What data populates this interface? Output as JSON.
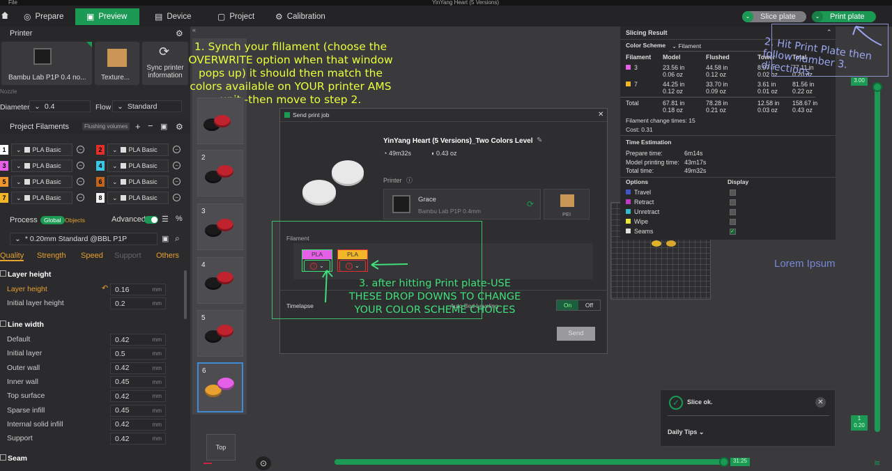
{
  "window": {
    "menu_file": "File",
    "title": "YinYang Heart (5 Versions)"
  },
  "topbar": {
    "tabs": [
      {
        "label": "Prepare",
        "active": false
      },
      {
        "label": "Preview",
        "active": true
      },
      {
        "label": "Device",
        "active": false
      },
      {
        "label": "Project",
        "active": false
      },
      {
        "label": "Calibration",
        "active": false
      }
    ],
    "slice_plate": "Slice plate",
    "print_plate": "Print plate"
  },
  "printer": {
    "header": "Printer",
    "name": "Bambu Lab P1P 0.4 no...",
    "plate": "Texture...",
    "sync_label": "Sync printer information",
    "nozzle_label": "Nozzle",
    "diameter_label": "Diameter",
    "diameter_value": "0.4",
    "flow_label": "Flow",
    "flow_value": "Standard"
  },
  "project_filaments": {
    "header": "Project Filaments",
    "flushing": "Flushing volumes",
    "slots": [
      {
        "num": "1",
        "name": "PLA Basic",
        "color": "#ffffff"
      },
      {
        "num": "2",
        "name": "PLA Basic",
        "color": "#e0302c"
      },
      {
        "num": "3",
        "name": "PLA Basic",
        "color": "#e560e6"
      },
      {
        "num": "4",
        "name": "PLA Basic",
        "color": "#3ec6e6"
      },
      {
        "num": "5",
        "name": "PLA Basic",
        "color": "#f0962e"
      },
      {
        "num": "6",
        "name": "PLA Basic",
        "color": "#c0651e"
      },
      {
        "num": "7",
        "name": "PLA Basic",
        "color": "#f2b629"
      },
      {
        "num": "8",
        "name": "PLA Basic",
        "color": "#f5f5f5"
      }
    ]
  },
  "process": {
    "header": "Process",
    "global": "Global",
    "objects": "Objects",
    "advanced": "Advanced",
    "preset": "* 0.20mm Standard @BBL P1P",
    "tabs": [
      "Quality",
      "Strength",
      "Speed",
      "Support",
      "Others"
    ],
    "layer_height_section": "Layer height",
    "layer_rows": [
      {
        "label": "Layer height",
        "value": "0.16",
        "unit": "mm"
      },
      {
        "label": "Initial layer height",
        "value": "0.2",
        "unit": "mm"
      }
    ],
    "line_width_section": "Line width",
    "line_rows": [
      {
        "label": "Default",
        "value": "0.42",
        "unit": "mm"
      },
      {
        "label": "Initial layer",
        "value": "0.5",
        "unit": "mm"
      },
      {
        "label": "Outer wall",
        "value": "0.42",
        "unit": "mm"
      },
      {
        "label": "Inner wall",
        "value": "0.45",
        "unit": "mm"
      },
      {
        "label": "Top surface",
        "value": "0.42",
        "unit": "mm"
      },
      {
        "label": "Sparse infill",
        "value": "0.45",
        "unit": "mm"
      },
      {
        "label": "Internal solid infill",
        "value": "0.42",
        "unit": "mm"
      },
      {
        "label": "Support",
        "value": "0.42",
        "unit": "mm"
      }
    ],
    "seam_section": "Seam"
  },
  "plates": [
    "",
    "2",
    "3",
    "4",
    "5",
    "6"
  ],
  "view_cube": "Top",
  "slicing": {
    "title": "Slicing Result",
    "color_scheme_label": "Color Scheme",
    "color_scheme_value": "Filament",
    "columns": [
      "Filament",
      "Model",
      "Flushed",
      "Tower",
      "Total"
    ],
    "rows": [
      {
        "id": "3",
        "color": "#e560e6",
        "model": [
          "23.56 in",
          "0.06 oz"
        ],
        "flushed": [
          "44.58 in",
          "0.12 oz"
        ],
        "tower": [
          "8.97 in",
          "0.02 oz"
        ],
        "total": [
          "77.11 in",
          "0.20 oz"
        ]
      },
      {
        "id": "7",
        "color": "#f2b629",
        "model": [
          "44.25 in",
          "0.12 oz"
        ],
        "flushed": [
          "33.70 in",
          "0.09 oz"
        ],
        "tower": [
          "3.61 in",
          "0.01 oz"
        ],
        "total": [
          "81.56 in",
          "0.22 oz"
        ]
      },
      {
        "id": "Total",
        "color": "",
        "model": [
          "67.81 in",
          "0.18 oz"
        ],
        "flushed": [
          "78.28 in",
          "0.21 oz"
        ],
        "tower": [
          "12.58 in",
          "0.03 oz"
        ],
        "total": [
          "158.67 in",
          "0.43 oz"
        ]
      }
    ],
    "change_times": "Filament change times:  15",
    "cost": "Cost:  0.31",
    "time_title": "Time Estimation",
    "times": [
      {
        "label": "Prepare time:",
        "value": "6m14s"
      },
      {
        "label": "Model printing time:",
        "value": "43m17s"
      },
      {
        "label": "Total time:",
        "value": "49m32s"
      }
    ],
    "options_label": "Options",
    "display_label": "Display",
    "options": [
      {
        "label": "Travel",
        "color": "#4455cc",
        "checked": false
      },
      {
        "label": "Retract",
        "color": "#c23ac4",
        "checked": false
      },
      {
        "label": "Unretract",
        "color": "#33bbcc",
        "checked": false
      },
      {
        "label": "Wipe",
        "color": "#e6e633",
        "checked": false
      },
      {
        "label": "Seams",
        "color": "#e0e0e0",
        "checked": true
      }
    ]
  },
  "dialog": {
    "title": "Send print job",
    "job_name": "YinYang Heart (5 Versions)_Two Colors Level",
    "time": "49m32s",
    "weight": "0.43 oz",
    "printer_label": "Printer",
    "printer_name": "Grace",
    "printer_model": "Bambu Lab P1P  0.4mm",
    "plate": "PEI",
    "filament_label": "Filament",
    "filaments": [
      {
        "type": "PLA",
        "color": "#e560e6"
      },
      {
        "type": "PLA",
        "color": "#f2b629"
      }
    ],
    "timelapse": "Timelapse",
    "auto_bed": "Auto Bed Leveling",
    "on": "On",
    "off": "Off",
    "send": "Send"
  },
  "notes": {
    "step1": "1.  Synch your fillament  (choose the OVERWRITE option when that window pops up) it should then match the colors available on YOUR printer AMS unit  -then move to step 2.",
    "step2": "2. Hit Print Plate then follow number 3. directions",
    "step3": "3. after hitting Print plate-USE THESE DROP DOWNS TO CHANGE YOUR COLOR SCHEME CHOICES",
    "lorem": "Lorem Ipsum"
  },
  "toast": {
    "message": "Slice ok.",
    "tips": "Daily Tips"
  },
  "slider": {
    "top_value": "3.00",
    "bottom_layer": "1",
    "bottom_value": "0.20",
    "time": "31:25"
  }
}
